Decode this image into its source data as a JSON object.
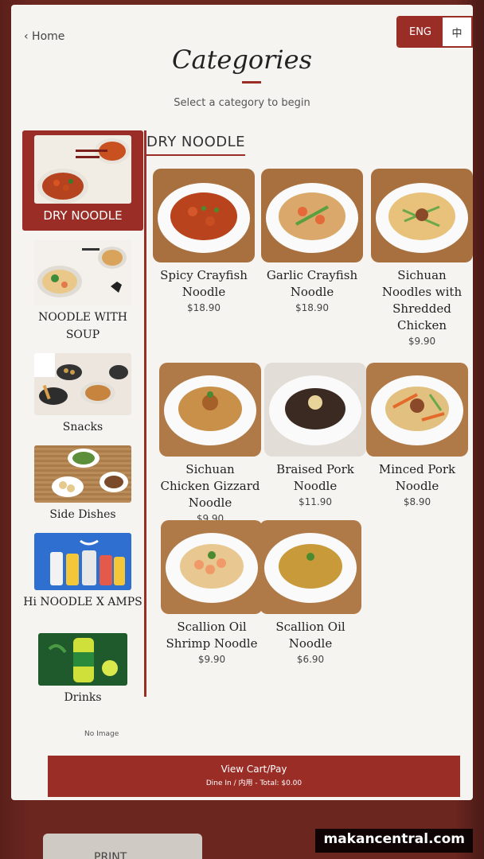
{
  "header": {
    "home_label": "‹ Home",
    "lang_active": "ENG",
    "lang_other": "中",
    "title": "Categories",
    "subtitle": "Select a category to begin"
  },
  "sidebar": {
    "items": [
      {
        "label": "DRY NOODLE",
        "active": true
      },
      {
        "label": "NOODLE WITH SOUP"
      },
      {
        "label": "Snacks"
      },
      {
        "label": "Side Dishes"
      },
      {
        "label": "Hi NOODLE X AMPS"
      },
      {
        "label": "Drinks"
      }
    ],
    "no_image": "No Image"
  },
  "section": {
    "title": "DRY NOODLE"
  },
  "menu": [
    {
      "name": "Spicy Crayfish Noodle",
      "price": "$18.90"
    },
    {
      "name": "Garlic Crayfish Noodle",
      "price": "$18.90"
    },
    {
      "name": "Sichuan Noodles with Shredded Chicken",
      "price": "$9.90"
    },
    {
      "name": "Sichuan Chicken Gizzard Noodle",
      "price": "$9.90"
    },
    {
      "name": "Braised Pork Noodle",
      "price": "$11.90"
    },
    {
      "name": "Minced Pork Noodle",
      "price": "$8.90"
    },
    {
      "name": "Scallion Oil Shrimp Noodle",
      "price": "$9.90"
    },
    {
      "name": "Scallion Oil Noodle",
      "price": "$6.90"
    }
  ],
  "cart": {
    "label": "View Cart/Pay",
    "detail": "Dine In / 内用 - Total: $0.00"
  },
  "print_label": "PRINT",
  "watermark": "makancentral.com",
  "colors": {
    "accent": "#9b2d27",
    "background": "#f6f4f1"
  }
}
